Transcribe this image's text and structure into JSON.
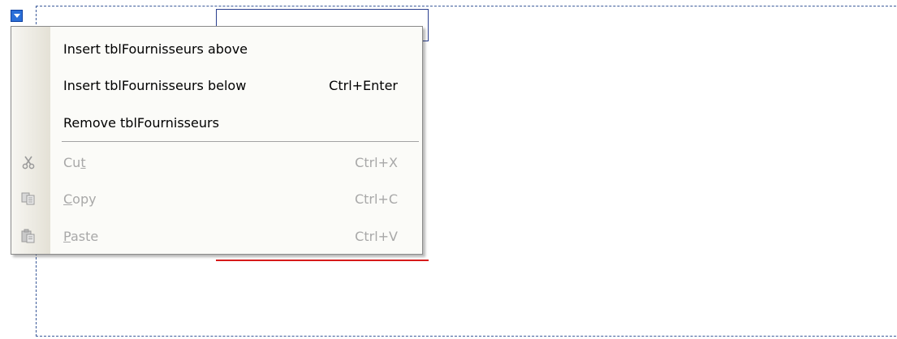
{
  "menu": {
    "items": [
      {
        "label": "Insert tblFournisseurs above",
        "shortcut": ""
      },
      {
        "label": "Insert tblFournisseurs below",
        "shortcut": "Ctrl+Enter"
      },
      {
        "label": "Remove tblFournisseurs",
        "shortcut": ""
      },
      {
        "label_before": "Cu",
        "label_mnemonic": "t",
        "label_after": "",
        "shortcut": "Ctrl+X",
        "icon": "scissors-icon"
      },
      {
        "label_before": "",
        "label_mnemonic": "C",
        "label_after": "opy",
        "shortcut": "Ctrl+C",
        "icon": "copy-icon"
      },
      {
        "label_before": "",
        "label_mnemonic": "P",
        "label_after": "aste",
        "shortcut": "Ctrl+V",
        "icon": "paste-icon"
      }
    ]
  },
  "colors": {
    "accent": "#2b6fd8",
    "frame_dash": "#3b5a9a",
    "red_line": "#d61a1a",
    "disabled_text": "#a8a8a8"
  }
}
